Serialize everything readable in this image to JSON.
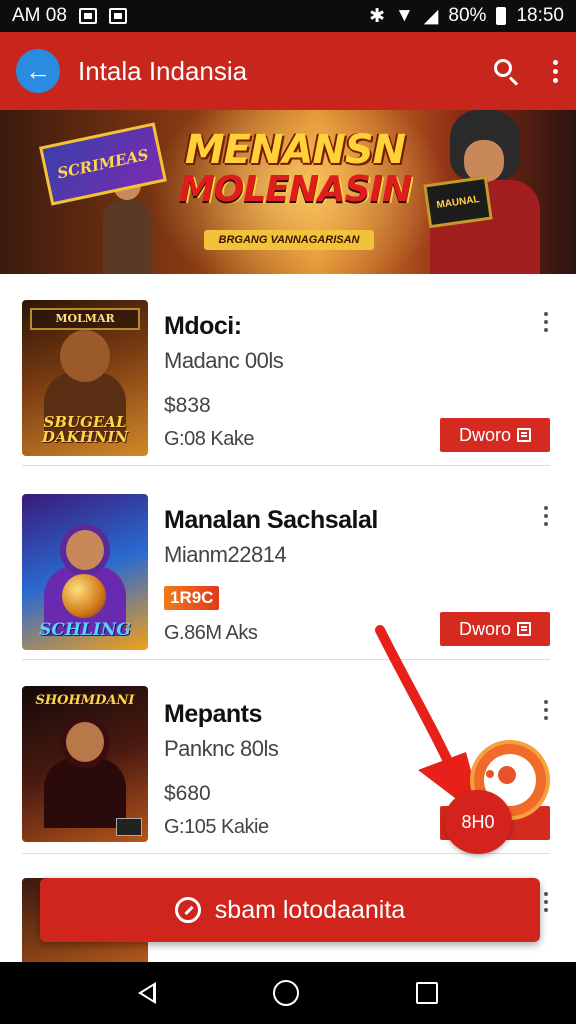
{
  "status_bar": {
    "carrier": "AM 08",
    "battery": "80%",
    "time": "18:50"
  },
  "toolbar": {
    "title": "Intala Indansia"
  },
  "banner": {
    "emblem_text": "SCRIMEAS",
    "title_line1": "MENANSN",
    "title_line2": "MOLENASIN",
    "subtitle": "BRGANG VANNAGARISAN",
    "card_text": "MAUNAL"
  },
  "items": [
    {
      "thumb_top": "MOLMAR",
      "thumb_label": "SBUGEAL DAKHNIN",
      "title": "Mdoci:",
      "subtitle": "Madanc 00ls",
      "price": "$838",
      "meta": "G:08 Kake",
      "button": "Dworo"
    },
    {
      "thumb_label": "SCHLING",
      "title": "Manalan Sachsalal",
      "subtitle": "Mianm22814",
      "price": "1R9C",
      "meta": "G.86M Aks",
      "button": "Dworo"
    },
    {
      "thumb_label": "SHOHMDANI",
      "title": "Mepants",
      "subtitle": "Panknc 80ls",
      "price": "$680",
      "meta": "G:105 Kakie",
      "button": "Dworo"
    }
  ],
  "overlay": {
    "hotspot_label": "8H0"
  },
  "install_bar": {
    "label": "sbam lotodaanita"
  },
  "colors": {
    "primary": "#c8261d",
    "accent_blue": "#2b8be0",
    "button_red": "#d42a1f"
  }
}
